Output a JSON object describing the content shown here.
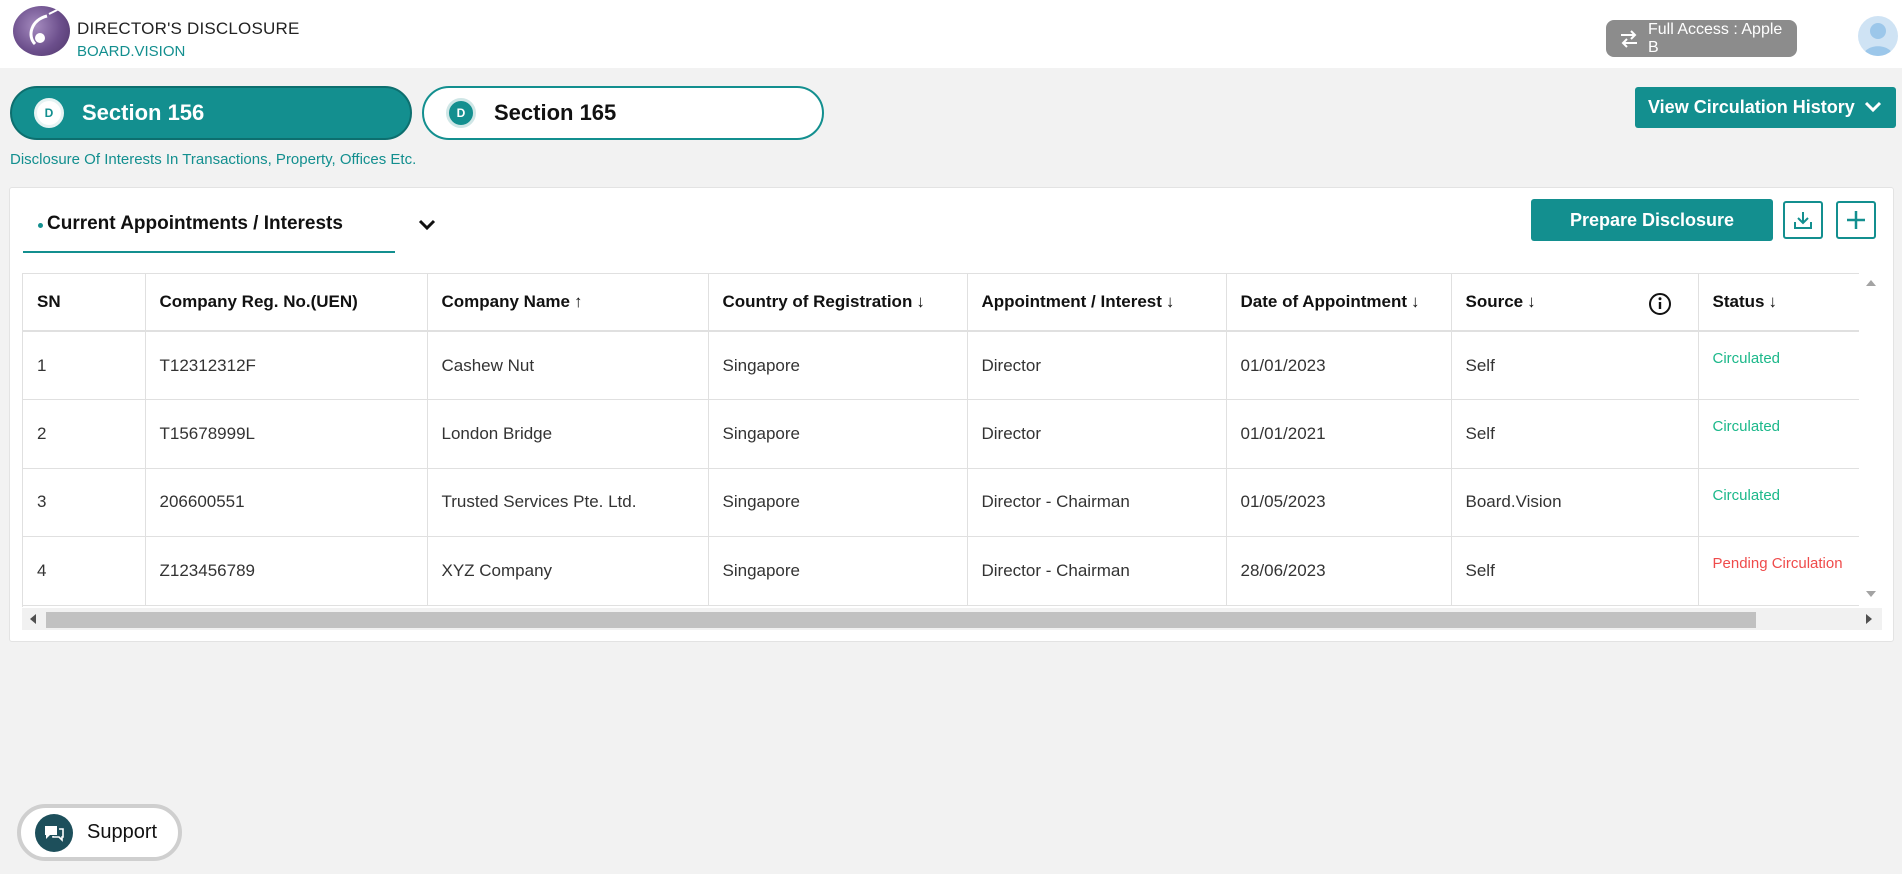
{
  "header": {
    "title": "DIRECTOR'S DISCLOSURE",
    "subtitle": "BOARD.VISION",
    "access_label": "Full Access : Apple B"
  },
  "sections": [
    {
      "badge": "D",
      "label": "Section 156",
      "active": true
    },
    {
      "badge": "D",
      "label": "Section 165",
      "active": false
    }
  ],
  "section_description": "Disclosure Of Interests In Transactions, Property, Offices Etc.",
  "view_history_label": "View Circulation History",
  "panel": {
    "tab_label": "Current Appointments / Interests",
    "prepare_label": "Prepare Disclosure"
  },
  "table": {
    "columns": [
      {
        "label": "SN",
        "arrow": ""
      },
      {
        "label": "Company Reg. No.(UEN)",
        "arrow": ""
      },
      {
        "label": "Company Name",
        "arrow": "↑"
      },
      {
        "label": "Country of Registration",
        "arrow": "↓"
      },
      {
        "label": "Appointment / Interest",
        "arrow": "↓"
      },
      {
        "label": "Date of Appointment",
        "arrow": "↓"
      },
      {
        "label": "Source",
        "arrow": "↓"
      },
      {
        "label": "Status",
        "arrow": "↓"
      }
    ],
    "rows": [
      {
        "sn": "1",
        "uen": "T12312312F",
        "company": "Cashew Nut",
        "country": "Singapore",
        "appointment": "Director",
        "date": "01/01/2023",
        "source": "Self",
        "status": "Circulated",
        "status_type": "circulated"
      },
      {
        "sn": "2",
        "uen": "T15678999L",
        "company": "London Bridge",
        "country": "Singapore",
        "appointment": "Director",
        "date": "01/01/2021",
        "source": "Self",
        "status": "Circulated",
        "status_type": "circulated"
      },
      {
        "sn": "3",
        "uen": "206600551",
        "company": "Trusted Services Pte. Ltd.",
        "country": "Singapore",
        "appointment": "Director - Chairman",
        "date": "01/05/2023",
        "source": "Board.Vision",
        "status": "Circulated",
        "status_type": "circulated"
      },
      {
        "sn": "4",
        "uen": "Z123456789",
        "company": "XYZ Company",
        "country": "Singapore",
        "appointment": "Director - Chairman",
        "date": "28/06/2023",
        "source": "Self",
        "status": "Pending Circulation",
        "status_type": "pending"
      }
    ]
  },
  "support_label": "Support",
  "colors": {
    "accent": "#138f8f",
    "circulated": "#1bb88a",
    "pending": "#ef4b4b"
  }
}
